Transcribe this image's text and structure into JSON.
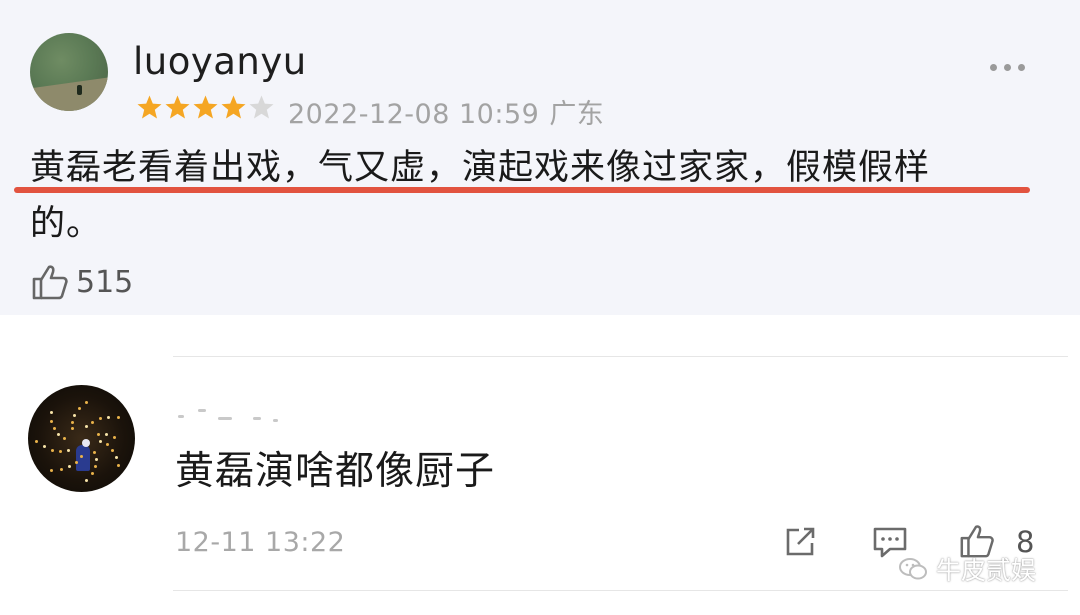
{
  "comment1": {
    "username": "luoyanyu",
    "rating": 4,
    "rating_max": 5,
    "date": "2022-12-08 10:59",
    "location": "广东",
    "text_line1": "黄磊老看着出戏，气又虚，演起戏来像过家家，假模假样",
    "text_line2": "的。",
    "like_count": "515",
    "highlight_color": "#e2533f"
  },
  "comment2": {
    "text": "黄磊演啥都像厨子",
    "time": "12-11 13:22",
    "like_count": "8"
  },
  "watermark": {
    "text": "牛皮贰娱"
  },
  "colors": {
    "star_active": "#f5a623",
    "star_inactive": "#d8d8d8",
    "card_bg": "#f4f5fa"
  }
}
